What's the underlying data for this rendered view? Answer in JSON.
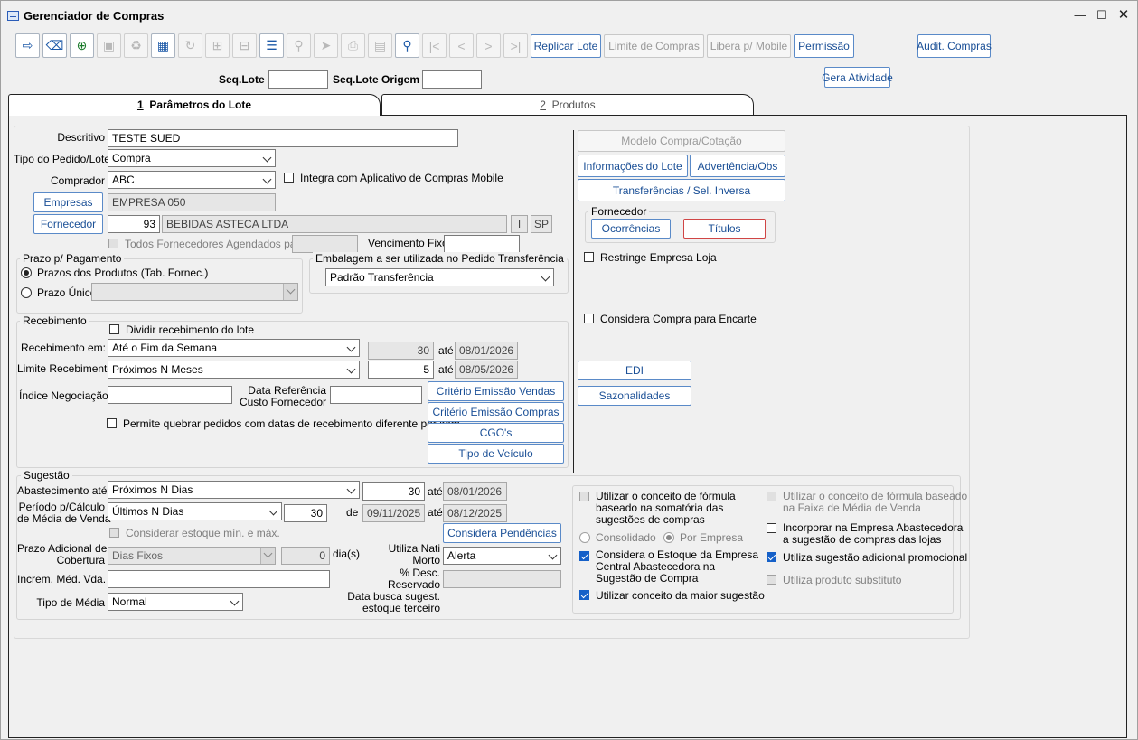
{
  "window": {
    "title": "Gerenciador de Compras"
  },
  "toolbar": {
    "buttons": [
      "exit-icon",
      "eraser-icon",
      "add-icon",
      "save-icon",
      "delete-icon",
      "grid-icon",
      "refresh-icon",
      "add-row-icon",
      "remove-row-icon",
      "filter-icon",
      "search-db-icon",
      "send-icon",
      "print-icon",
      "clipboard-icon",
      "search-icon",
      "first-icon",
      "prev-icon",
      "next-icon",
      "last-icon"
    ],
    "replicar_lote": "Replicar Lote",
    "limite_compras": "Limite de Compras",
    "libera_mobile": "Libera p/ Mobile",
    "permissao": "Permissão",
    "audit_compras": "Audit. Compras",
    "gera_atividade": "Gera Atividade"
  },
  "header": {
    "seq_lote_label": "Seq.Lote",
    "seq_lote_value": "",
    "seq_lote_origem_label": "Seq.Lote Origem",
    "seq_lote_origem_value": ""
  },
  "tabs": [
    {
      "num": "1",
      "label": "Parâmetros do Lote"
    },
    {
      "num": "2",
      "label": "Produtos"
    }
  ],
  "form": {
    "descritivo_label": "Descritivo",
    "descritivo": "TESTE SUED",
    "tipo_pedido_label": "Tipo do Pedido/Lote",
    "tipo_pedido": "Compra",
    "comprador_label": "Comprador",
    "comprador": "ABC",
    "integra_mobile": "Integra com Aplicativo de Compras Mobile",
    "empresas_btn": "Empresas",
    "empresas": "EMPRESA 050",
    "fornecedor_btn": "Fornecedor",
    "fornecedor_code": "93",
    "fornecedor_name": "BEBIDAS ASTECA LTDA",
    "fornecedor_i": "I",
    "fornecedor_uf": "SP",
    "todos_fornecedores": "Todos Fornecedores Agendados para",
    "vencimento_fixo": "Vencimento Fixo"
  },
  "prazo": {
    "title": "Prazo p/ Pagamento",
    "prazos_produtos": "Prazos dos Produtos (Tab. Fornec.)",
    "prazo_unico": "Prazo Único"
  },
  "embalagem": {
    "title": "Embalagem a ser utilizada no Pedido Transferência",
    "value": "Padrão Transferência"
  },
  "recebimento": {
    "title": "Recebimento",
    "dividir": "Dividir recebimento do lote",
    "recebimento_em_label": "Recebimento em:",
    "recebimento_em": "Até o Fim da Semana",
    "recebimento_num": "30",
    "ate1": "até",
    "recebimento_date": "08/01/2026",
    "limite_label": "Limite Recebimento:",
    "limite": "Próximos N Meses",
    "limite_num": "5",
    "ate2": "até",
    "limite_date": "08/05/2026",
    "indice_label": "Índice Negociação",
    "data_ref_label1": "Data Referência",
    "data_ref_label2": "Custo Fornecedor",
    "permite_quebrar": "Permite quebrar pedidos com datas de recebimento diferente por item",
    "criterio_vendas": "Critério Emissão Vendas",
    "criterio_compras": "Critério Emissão Compras",
    "cgos": "CGO's",
    "tipo_veiculo": "Tipo de Veículo"
  },
  "right": {
    "modelo_compra": "Modelo Compra/Cotação",
    "info_lote": "Informações do Lote",
    "advertencia": "Advertência/Obs",
    "transferencias": "Transferências / Sel. Inversa",
    "fornecedor_title": "Fornecedor",
    "ocorrencias": "Ocorrências",
    "titulos": "Títulos",
    "restringe": "Restringe Empresa Loja",
    "considera_encarte": "Considera Compra para Encarte",
    "edi": "EDI",
    "sazonalidades": "Sazonalidades"
  },
  "sugestao": {
    "title": "Sugestão",
    "abastecimento_label": "Abastecimento até",
    "abastecimento": "Próximos N Dias",
    "abastecimento_num": "30",
    "ate1": "até",
    "abastecimento_date": "08/01/2026",
    "periodo_label1": "Período p/Cálculo",
    "periodo_label2": "de Média de Venda",
    "periodo": "Últimos N Dias",
    "periodo_num": "30",
    "de": "de",
    "periodo_from": "09/11/2025",
    "ate2": "até",
    "periodo_to": "08/12/2025",
    "considerar_estoque": "Considerar estoque mín. e máx.",
    "considera_pendencias": "Considera Pendências",
    "prazo_adicional_label1": "Prazo Adicional de",
    "prazo_adicional_label2": "Cobertura",
    "prazo_adicional": "Dias Fixos",
    "prazo_adicional_num": "0",
    "dias": "dia(s)",
    "utiliza_nati_label1": "Utiliza Nati",
    "utiliza_nati_label2": "Morto",
    "utiliza_nati": "Alerta",
    "increm_label": "Increm. Méd. Vda.",
    "desc_reservado_label1": "% Desc.",
    "desc_reservado_label2": "Reservado",
    "tipo_media_label": "Tipo de Média",
    "tipo_media": "Normal",
    "data_busca_label1": "Data busca sugest.",
    "data_busca_label2": "estoque terceiro"
  },
  "opcoes": {
    "formula_somatoria": [
      "Utilizar o conceito de fórmula",
      "baseado na somatória das",
      "sugestões de compras"
    ],
    "consolidado": "Consolidado",
    "por_empresa": "Por Empresa",
    "considera_estoque_central": [
      "Considera o Estoque da Empresa",
      "Central Abastecedora na",
      "Sugestão de Compra"
    ],
    "maior_sugestao": "Utilizar conceito da maior sugestão",
    "formula_faixa": [
      "Utilizar o conceito de fórmula baseado",
      "na Faixa de Média de Venda"
    ],
    "incorporar": [
      "Incorporar na Empresa Abastecedora",
      "a sugestão de compras das lojas"
    ],
    "sugestao_promocional": "Utiliza sugestão adicional promocional",
    "produto_substituto": "Utiliza produto substituto"
  }
}
